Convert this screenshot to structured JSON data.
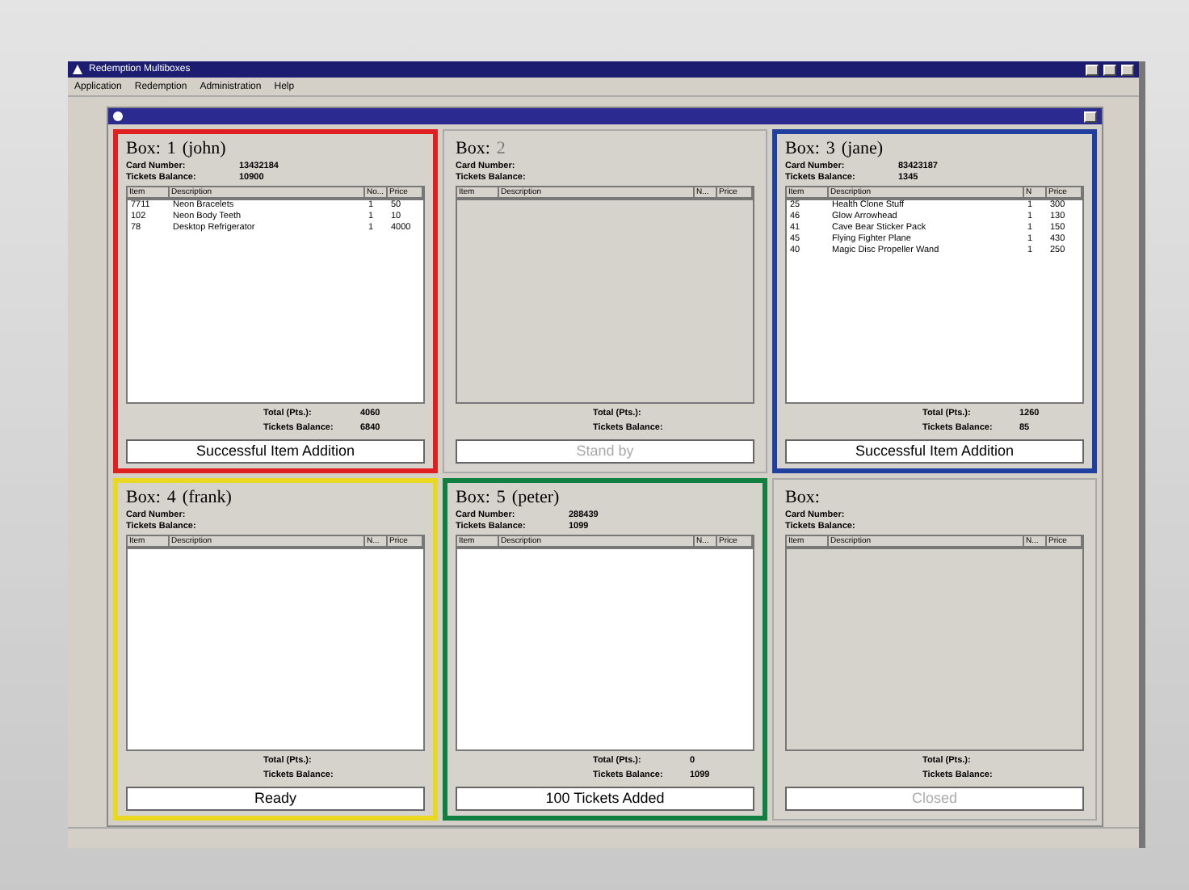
{
  "window": {
    "title": "Redemption Multiboxes"
  },
  "menu": [
    "Application",
    "Redemption",
    "Administration",
    "Help"
  ],
  "boxes": [
    {
      "color": "#e02020",
      "active": true,
      "title": "Box:",
      "number": "1",
      "name": "(john)",
      "card_label": "Card Number:",
      "card": "13432184",
      "balance_label": "Tickets Balance:",
      "balance": "10900",
      "columns": [
        "Item",
        "Description",
        "No...",
        "Price"
      ],
      "items": [
        [
          "7711",
          "Neon Bracelets",
          "1",
          "50"
        ],
        [
          "102",
          "Neon Body Teeth",
          "1",
          "10"
        ],
        [
          "78",
          "Desktop Refrigerator",
          "1",
          "4000"
        ]
      ],
      "total_label": "Total (Pts.):",
      "total": "4060",
      "after_label": "Tickets Balance:",
      "after": "6840",
      "status": "Successful Item Addition"
    },
    {
      "active": false,
      "title": "Box:",
      "number": "2",
      "card_label": "Card Number:",
      "balance_label": "Tickets Balance:",
      "columns": [
        "Item",
        "Description",
        "N...",
        "Price"
      ],
      "total_label": "Total (Pts.):",
      "after_label": "Tickets Balance:",
      "status": "Stand by"
    },
    {
      "color": "#2040a0",
      "active": true,
      "title": "Box:",
      "number": "3",
      "name": "(jane)",
      "card_label": "Card Number:",
      "card": "83423187",
      "balance_label": "Tickets Balance:",
      "balance": "1345",
      "columns": [
        "Item",
        "Description",
        "N",
        "Price"
      ],
      "items": [
        [
          "25",
          "Health Clone Stuff",
          "1",
          "300"
        ],
        [
          "46",
          "Glow Arrowhead",
          "1",
          "130"
        ],
        [
          "41",
          "Cave Bear Sticker Pack",
          "1",
          "150"
        ],
        [
          "45",
          "Flying Fighter Plane",
          "1",
          "430"
        ],
        [
          "40",
          "Magic Disc Propeller Wand",
          "1",
          "250"
        ]
      ],
      "total_label": "Total (Pts.):",
      "total": "1260",
      "after_label": "Tickets Balance:",
      "after": "85",
      "status": "Successful Item Addition"
    },
    {
      "color": "#e8d820",
      "active": true,
      "title": "Box:",
      "number": "4",
      "name": "(frank)",
      "card_label": "Card Number:",
      "balance_label": "Tickets Balance:",
      "columns": [
        "Item",
        "Description",
        "N...",
        "Price"
      ],
      "total_label": "Total (Pts.):",
      "after_label": "Tickets Balance:",
      "status": "Ready"
    },
    {
      "color": "#108040",
      "active": true,
      "title": "Box:",
      "number": "5",
      "name": "(peter)",
      "card_label": "Card Number:",
      "card": "288439",
      "balance_label": "Tickets Balance:",
      "balance": "1099",
      "columns": [
        "Item",
        "Description",
        "N...",
        "Price"
      ],
      "total_label": "Total (Pts.):",
      "total": "0",
      "after_label": "Tickets Balance:",
      "after": "1099",
      "status": "100 Tickets Added"
    },
    {
      "active": false,
      "title": "Box:",
      "card_label": "Card Number:",
      "balance_label": "Tickets Balance:",
      "columns": [
        "Item",
        "Description",
        "N...",
        "Price"
      ],
      "total_label": "Total (Pts.):",
      "after_label": "Tickets Balance:",
      "status": "Closed"
    }
  ]
}
